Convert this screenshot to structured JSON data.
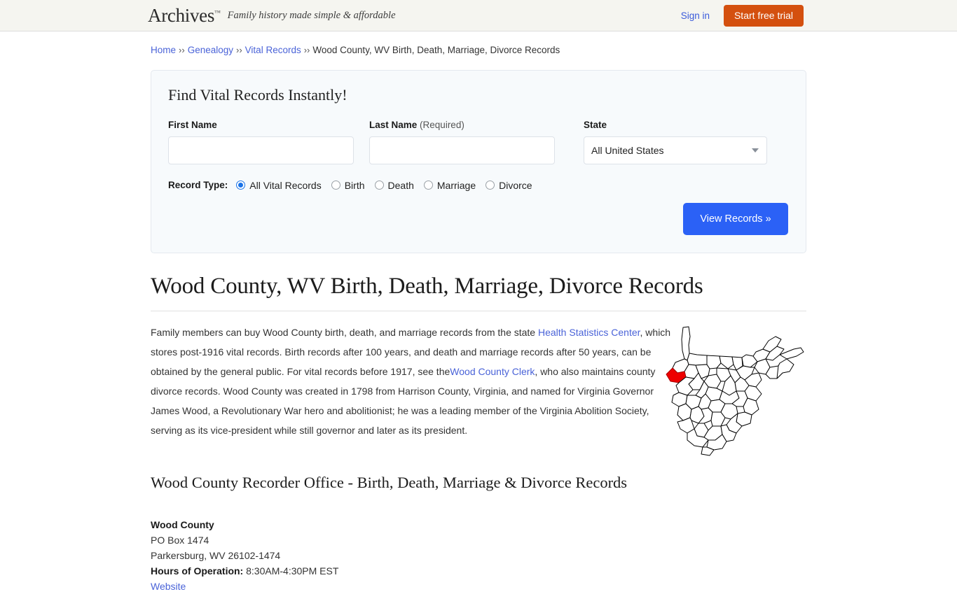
{
  "header": {
    "logo": "Archives",
    "logo_tm": "™",
    "tagline": "Family history made simple & affordable",
    "sign_in": "Sign in",
    "start_trial": "Start free trial",
    "trial_color": "#d4500f",
    "link_color": "#3b5bdb"
  },
  "breadcrumb": {
    "separator": "››",
    "items": [
      {
        "label": "Home",
        "link": true
      },
      {
        "label": "Genealogy",
        "link": true
      },
      {
        "label": "Vital Records",
        "link": true
      },
      {
        "label": "Wood County, WV Birth, Death, Marriage, Divorce Records",
        "link": false
      }
    ]
  },
  "search_panel": {
    "title": "Find Vital Records Instantly!",
    "first_name": {
      "label": "First Name",
      "value": "",
      "placeholder": ""
    },
    "last_name": {
      "label": "Last Name",
      "required_note": "(Required)",
      "value": "",
      "placeholder": ""
    },
    "state": {
      "label": "State",
      "value": "All United States",
      "caret_icon": "chevron-down-icon"
    },
    "record_type": {
      "label": "Record Type:",
      "selected": "All Vital Records",
      "options": [
        "All Vital Records",
        "Birth",
        "Death",
        "Marriage",
        "Divorce"
      ]
    },
    "submit_label": "View Records »",
    "submit_color": "#2b61f6"
  },
  "main": {
    "heading": "Wood County, WV Birth, Death, Marriage, Divorce Records",
    "paragraph": {
      "part1": "Family members can buy Wood County birth, death, and marriage records from the state ",
      "link1": "Health Statistics Center",
      "part2": ", which stores post-1916 vital records. Birth records after 100 years, and death and marriage records after 50 years, can be obtained by the general public. For vital records before 1917, see the",
      "link2": "Wood County Clerk",
      "part3": ", who also maintains county divorce records. Wood County was created in 1798 from Harrison County, Virginia, and named for Virginia Governor James Wood, a Revolutionary War hero and abolitionist; he was a leading member of the Virginia Abolition Society, serving as its vice-president while still governor and later as its president."
    },
    "map": {
      "name": "west-virginia-county-map",
      "highlight_county": "Wood County",
      "highlight_color": "#ee0000"
    },
    "sub_heading": "Wood County Recorder Office - Birth, Death, Marriage & Divorce Records",
    "address": {
      "name": "Wood County",
      "line1": "PO Box 1474",
      "line2": "Parkersburg, WV 26102-1474",
      "hours_label": "Hours of Operation:",
      "hours_value": "8:30AM-4:30PM EST",
      "website_label": "Website"
    }
  }
}
